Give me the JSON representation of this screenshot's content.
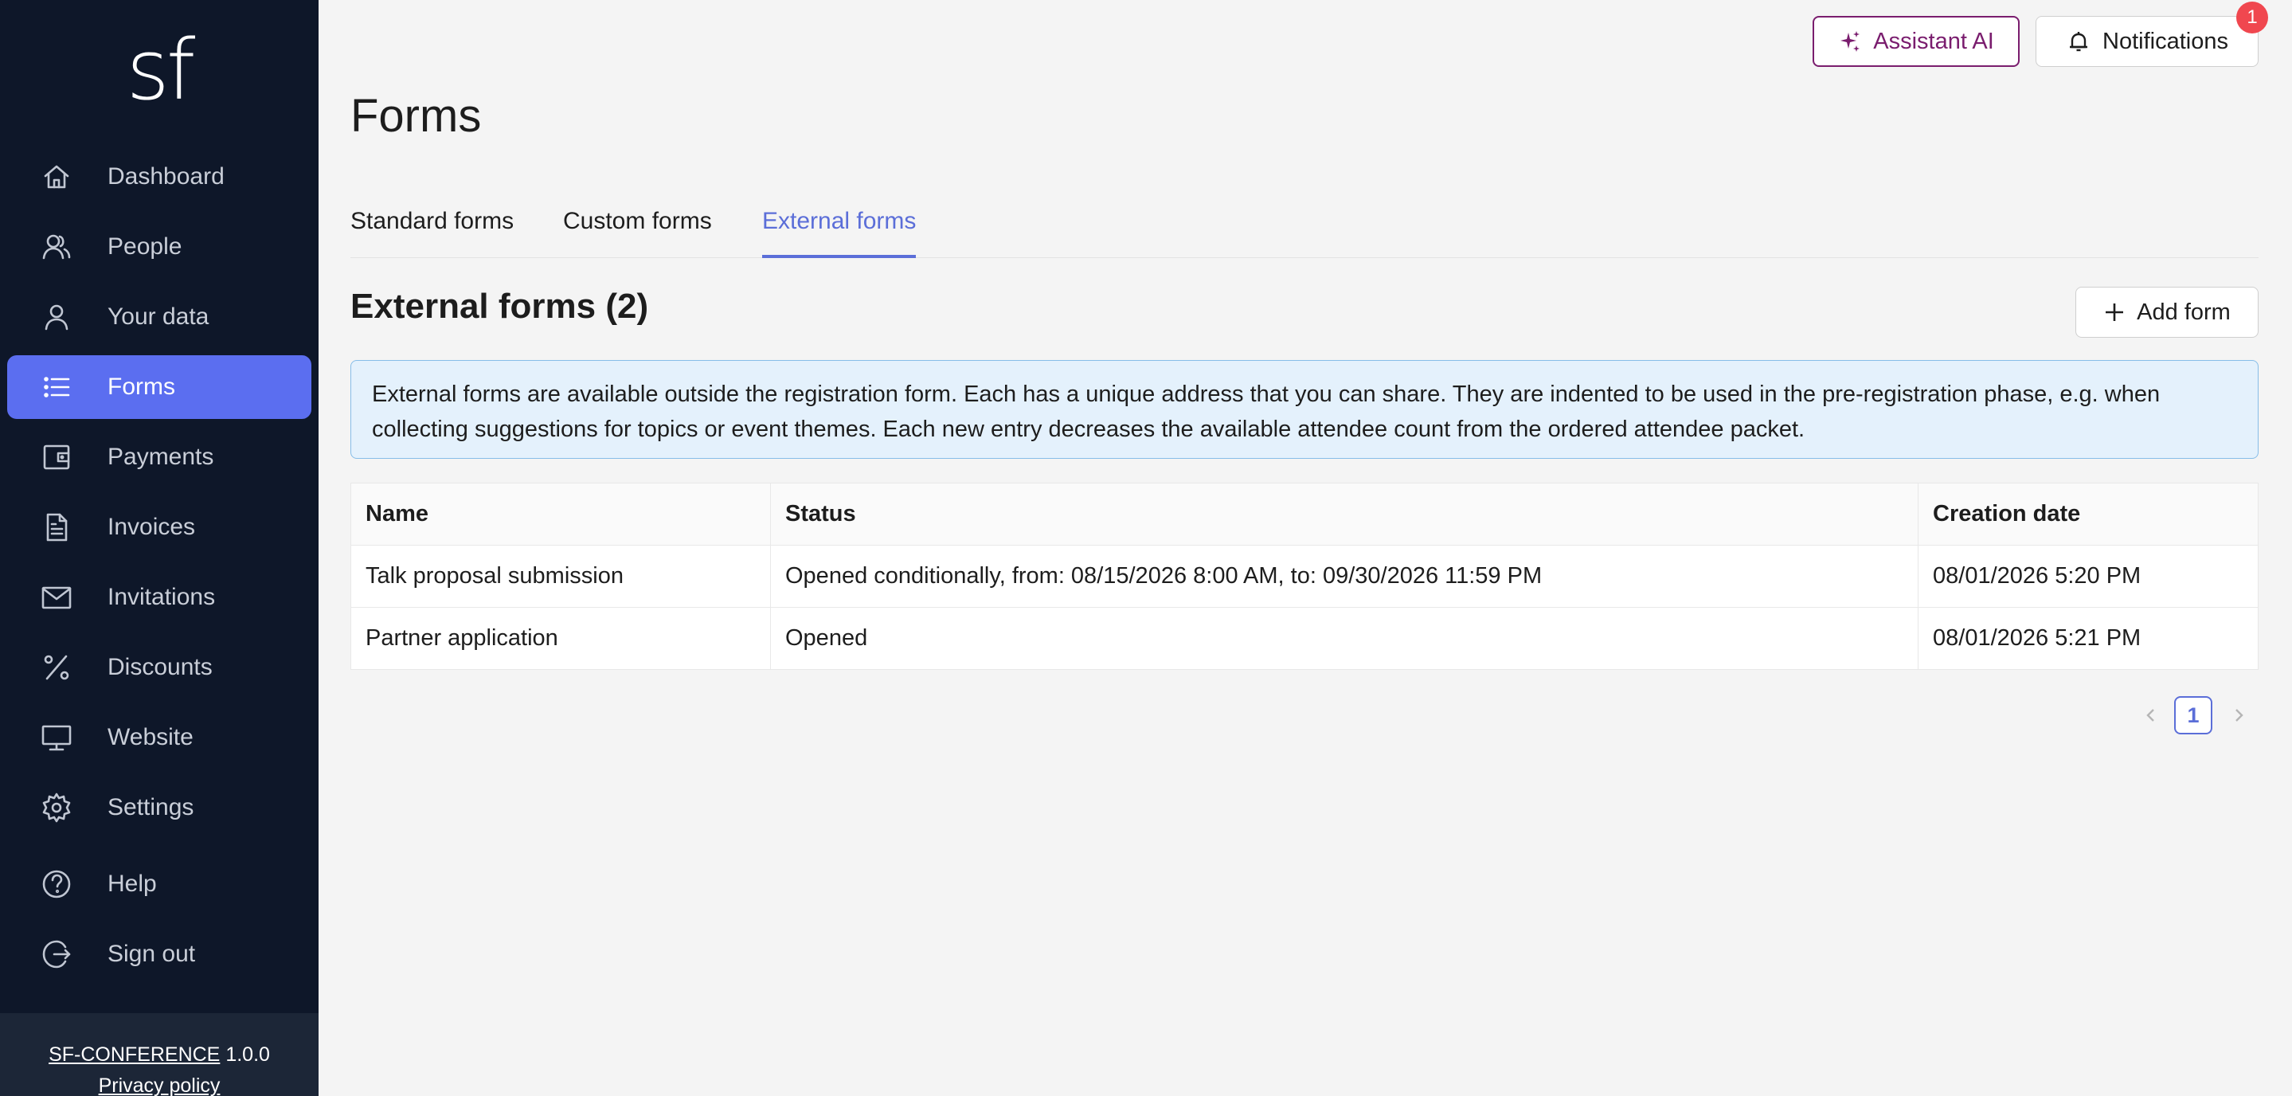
{
  "sidebar": {
    "logo": "sf",
    "items": [
      {
        "label": "Dashboard",
        "icon": "home-icon"
      },
      {
        "label": "People",
        "icon": "people-icon"
      },
      {
        "label": "Your data",
        "icon": "user-icon"
      },
      {
        "label": "Forms",
        "icon": "list-icon",
        "active": true
      },
      {
        "label": "Payments",
        "icon": "wallet-icon"
      },
      {
        "label": "Invoices",
        "icon": "document-icon"
      },
      {
        "label": "Invitations",
        "icon": "mail-icon"
      },
      {
        "label": "Discounts",
        "icon": "percent-icon"
      },
      {
        "label": "Website",
        "icon": "monitor-icon"
      },
      {
        "label": "Settings",
        "icon": "gear-icon"
      },
      {
        "label": "Help",
        "icon": "help-icon"
      },
      {
        "label": "Sign out",
        "icon": "sign-out-icon"
      }
    ],
    "footer": {
      "brand": "SF-CONFERENCE",
      "version": "1.0.0",
      "privacy": "Privacy policy"
    }
  },
  "header": {
    "assistant_label": "Assistant AI",
    "notifications_label": "Notifications",
    "notifications_count": "1"
  },
  "main": {
    "title": "Forms",
    "tabs": [
      {
        "label": "Standard forms"
      },
      {
        "label": "Custom forms"
      },
      {
        "label": "External forms",
        "active": true
      }
    ],
    "section_title": "External forms (2)",
    "add_button": "Add form",
    "info": "External forms are available outside the registration form. Each has a unique address that you can share. They are indented to be used in the pre-registration phase, e.g. when collecting suggestions for topics or event themes. Each new entry decreases the available attendee count from the ordered attendee packet.",
    "table": {
      "columns": [
        "Name",
        "Status",
        "Creation date"
      ],
      "rows": [
        [
          "Talk proposal submission",
          "Opened conditionally, from: 08/15/2026 8:00 AM, to: 09/30/2026 11:59 PM",
          "08/01/2026 5:20 PM"
        ],
        [
          "Partner application",
          "Opened",
          "08/01/2026 5:21 PM"
        ]
      ]
    },
    "pagination": {
      "current": "1"
    }
  },
  "colors": {
    "sidebar_bg": "#0e1729",
    "active_nav": "#5b6ef0",
    "accent": "#5b6ed8",
    "ai_accent": "#7a1d6e",
    "badge": "#f0474f"
  }
}
